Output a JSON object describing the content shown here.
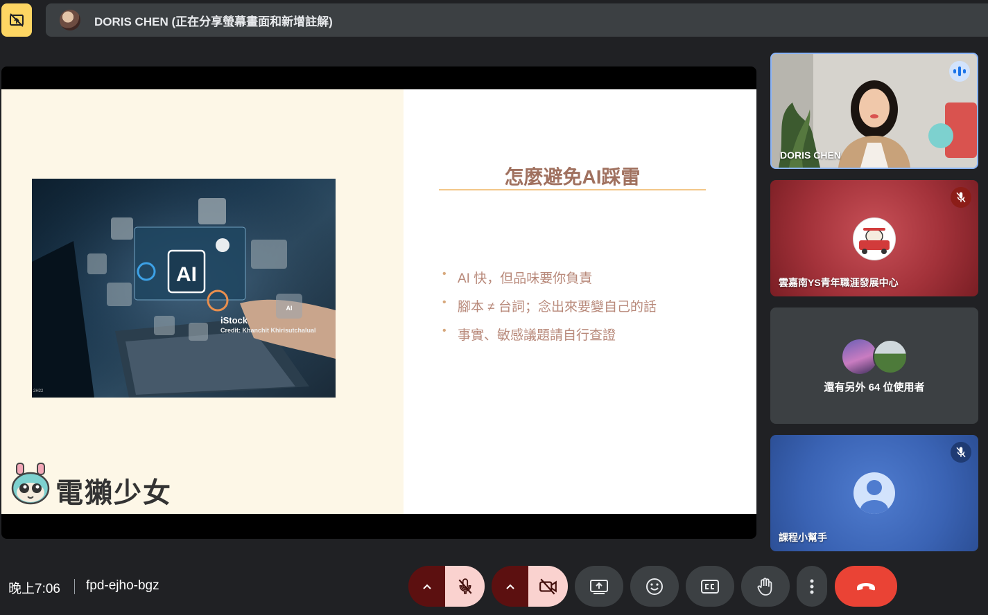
{
  "presentation_bar": {
    "stop_icon": "present-to-all-off-icon",
    "title": "DORIS CHEN (正在分享螢幕畫面和新增註解)"
  },
  "slide": {
    "title": "怎麼避免AI踩雷",
    "bullets": [
      "AI 快，但品味要你負責",
      "腳本 ≠ 台詞；念出來要變自己的話",
      "事實、敏感議題請自行查證"
    ],
    "photo": {
      "watermark": "iStock",
      "credit": "Credit: Khanchit Khirisutchalual",
      "code": "2H22",
      "center_label": "AI",
      "chip_label": "AI"
    },
    "brand": "電獺少女"
  },
  "participants": [
    {
      "name": "DORIS CHEN",
      "state": "speaking"
    },
    {
      "name": "雲嘉南YS青年職涯發展中心",
      "state": "muted"
    },
    {
      "name": "還有另外 64 位使用者",
      "state": "others"
    },
    {
      "name": "課程小幫手",
      "state": "muted"
    }
  ],
  "footer": {
    "time": "晚上7:06",
    "meeting_code": "fpd-ejho-bgz"
  },
  "controls": {
    "mic": "mic-off-icon",
    "camera": "videocam-off-icon",
    "present": "present-to-all-icon",
    "reactions": "emoji-icon",
    "captions": "closed-caption-icon",
    "raise_hand": "hand-icon",
    "more": "more-vert-icon",
    "leave": "call-end-icon"
  },
  "colors": {
    "accent_yellow": "#fdd663",
    "leave_red": "#ea4335",
    "muted_red": "#fad2cf",
    "slide_title": "#a0715f",
    "slide_bullets": "#b8897a"
  }
}
